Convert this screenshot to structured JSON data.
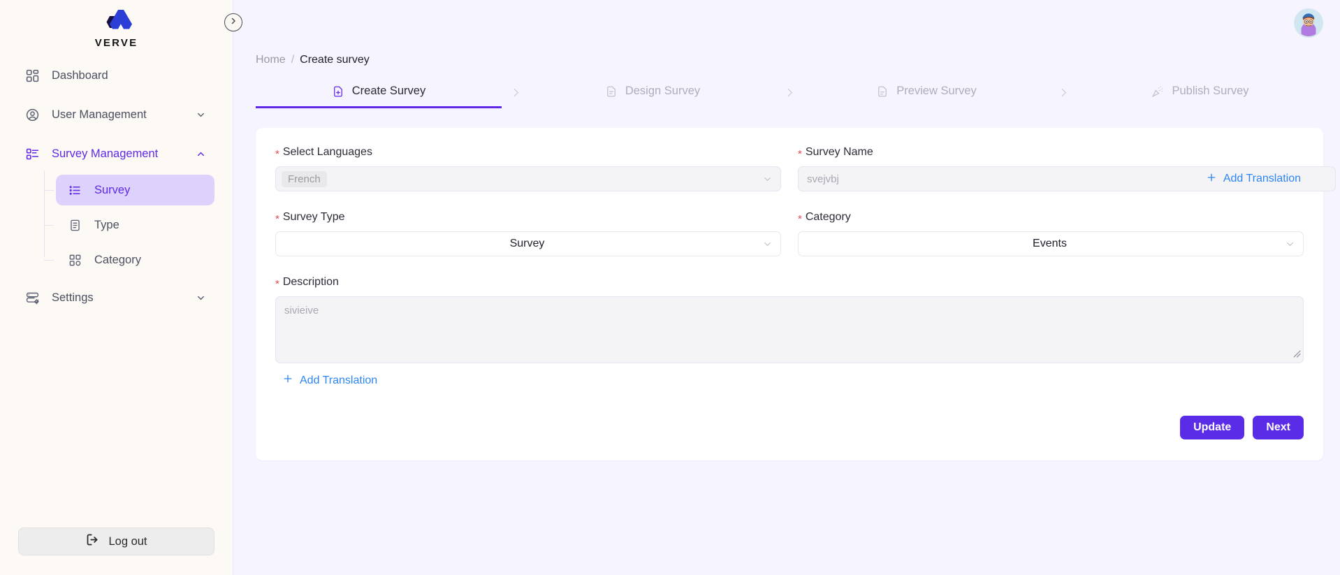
{
  "brand": {
    "name": "VERVE",
    "accent": "#6028e8",
    "logo_dark": "#16103f",
    "logo_blue": "#2b3fd6"
  },
  "sidebar": {
    "items": [
      {
        "label": "Dashboard",
        "icon": "dashboard-grid-icon",
        "chevron": ""
      },
      {
        "label": "User Management",
        "icon": "user-circle-icon",
        "chevron": "chevron-down-icon"
      },
      {
        "label": "Survey Management",
        "icon": "survey-list-icon",
        "chevron": "chevron-up-icon"
      }
    ],
    "sub_items": [
      {
        "label": "Survey",
        "icon": "list-icon"
      },
      {
        "label": "Type",
        "icon": "document-icon"
      },
      {
        "label": "Category",
        "icon": "category-grid-icon"
      }
    ],
    "settings": {
      "label": "Settings",
      "icon": "server-gear-icon",
      "chevron": "chevron-down-icon"
    },
    "logout": {
      "label": "Log out",
      "icon": "logout-icon"
    },
    "collapse": {
      "icon": "chevron-right-circle-icon"
    }
  },
  "topbar": {
    "avatar": "user-avatar"
  },
  "breadcrumb": {
    "home": "Home",
    "separator": "/",
    "current": "Create survey"
  },
  "stepper": {
    "steps": [
      {
        "label": "Create Survey",
        "icon": "file-plus-icon",
        "active": true
      },
      {
        "label": "Design Survey",
        "icon": "file-edit-icon",
        "active": false
      },
      {
        "label": "Preview Survey",
        "icon": "file-preview-icon",
        "active": false
      },
      {
        "label": "Publish Survey",
        "icon": "confetti-icon",
        "active": false
      }
    ],
    "arrow": "chevron-right-icon"
  },
  "form": {
    "languages": {
      "label": "Select Languages",
      "required": "*",
      "chip": "French",
      "caret": "chevron-down-icon"
    },
    "survey_name": {
      "label": "Survey Name",
      "required": "*",
      "placeholder": "svejvbj",
      "value": ""
    },
    "survey_type": {
      "label": "Survey Type",
      "required": "*",
      "value": "Survey",
      "caret": "chevron-down-icon"
    },
    "category": {
      "label": "Category",
      "required": "*",
      "value": "Events",
      "caret": "chevron-down-icon"
    },
    "description": {
      "label": "Description",
      "required": "*",
      "placeholder": "sivieive",
      "value": ""
    },
    "add_translation_name": {
      "label": "Add Translation",
      "icon": "plus-icon"
    },
    "add_translation_desc": {
      "label": "Add Translation",
      "icon": "plus-icon"
    }
  },
  "actions": {
    "update": "Update",
    "next": "Next"
  }
}
